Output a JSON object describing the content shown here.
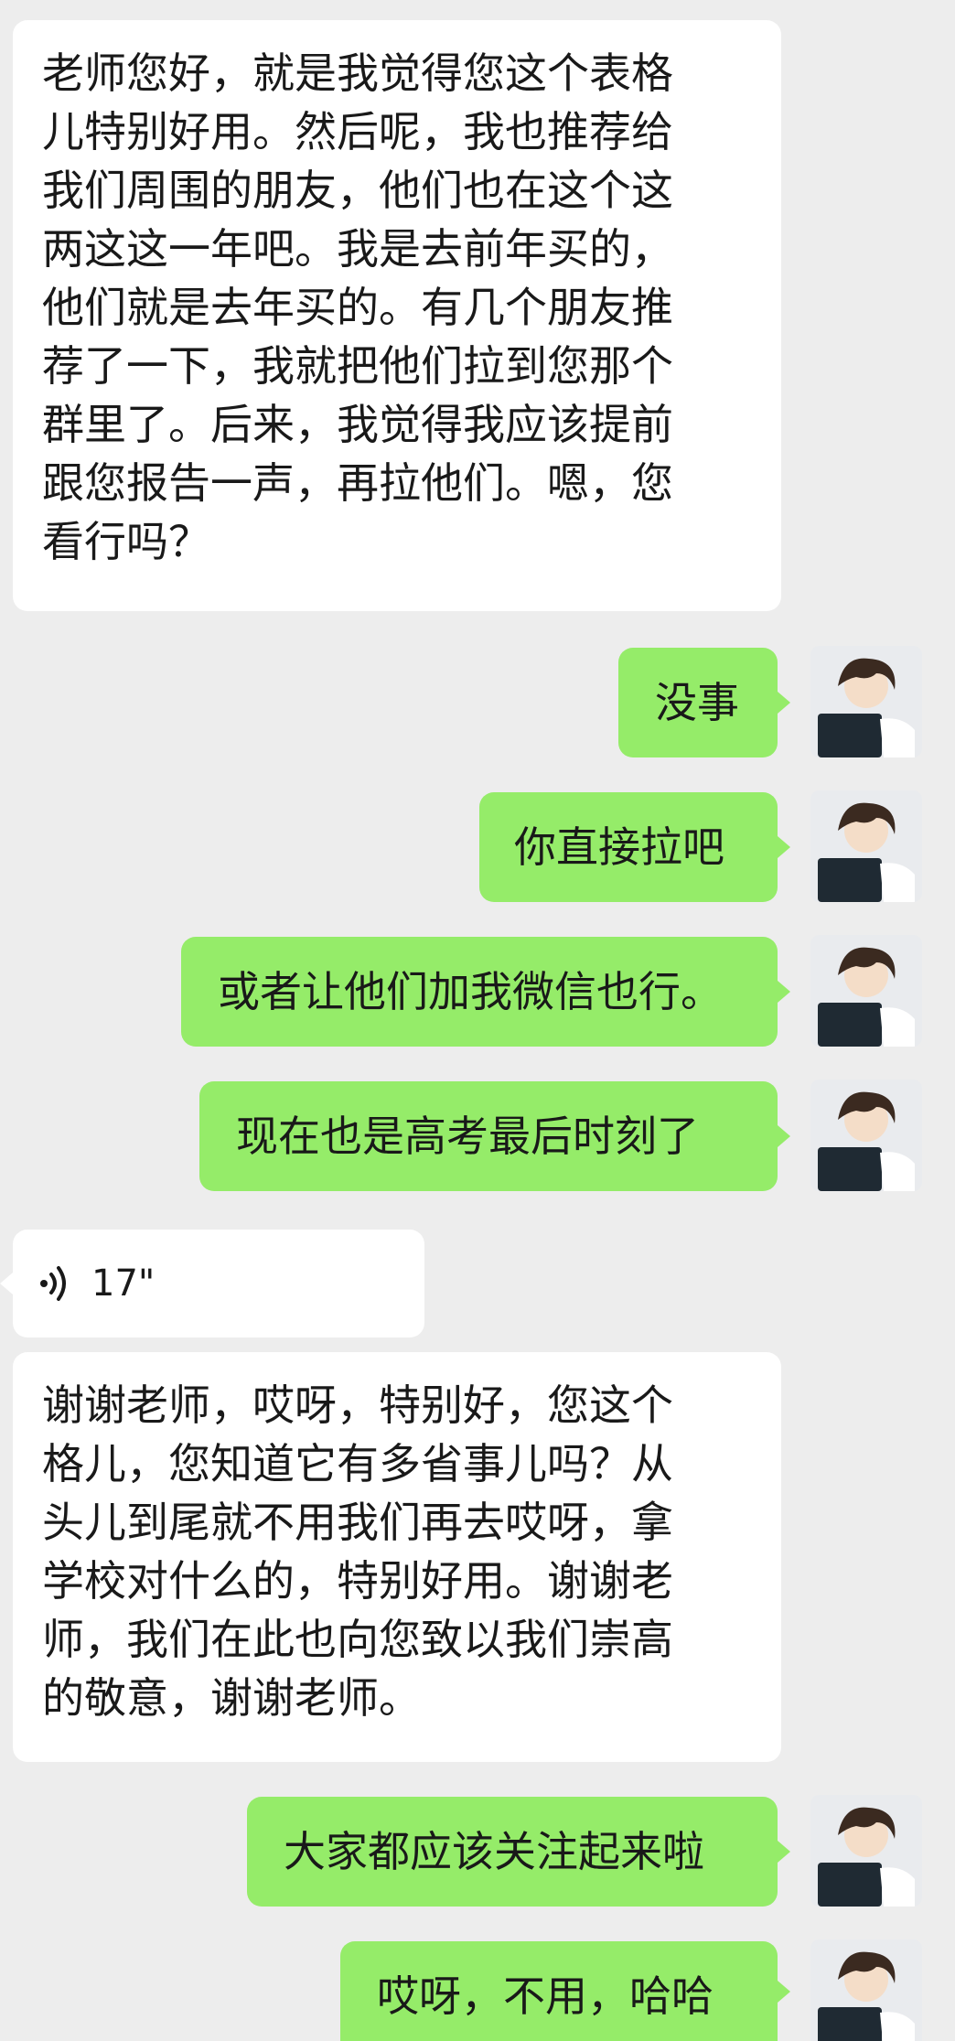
{
  "messages": [
    {
      "type": "text",
      "direction": "incoming",
      "text": "老师您好，就是我觉得您这个表格\n儿特别好用。然后呢，我也推荐给\n我们周围的朋友，他们也在这个这\n两这这一年吧。我是去前年买的，\n他们就是去年买的。有几个朋友推\n荐了一下，我就把他们拉到您那个\n群里了。后来，我觉得我应该提前\n跟您报告一声，再拉他们。嗯，您\n看行吗？"
    },
    {
      "type": "text",
      "direction": "outgoing",
      "text": "没事"
    },
    {
      "type": "text",
      "direction": "outgoing",
      "text": "你直接拉吧"
    },
    {
      "type": "text",
      "direction": "outgoing",
      "text": "或者让他们加我微信也行。"
    },
    {
      "type": "text",
      "direction": "outgoing",
      "text": "现在也是高考最后时刻了"
    },
    {
      "type": "voice",
      "direction": "incoming",
      "duration": "17\"",
      "icon": "voice-wave-icon"
    },
    {
      "type": "text",
      "direction": "incoming",
      "text": "谢谢老师，哎呀，特别好，您这个\n格儿，您知道它有多省事儿吗？从\n头儿到尾就不用我们再去哎呀，拿\n学校对什么的，特别好用。谢谢老\n师，我们在此也向您致以我们崇高\n的敬意，谢谢老师。"
    },
    {
      "type": "text",
      "direction": "outgoing",
      "text": "大家都应该关注起来啦"
    },
    {
      "type": "text",
      "direction": "outgoing",
      "text": "哎呀，不用，哈哈"
    }
  ],
  "colors": {
    "background": "#ededed",
    "incoming_bubble": "#ffffff",
    "outgoing_bubble": "#95ec69",
    "text": "#191919"
  },
  "avatar": {
    "icon": "user-avatar-icon"
  }
}
